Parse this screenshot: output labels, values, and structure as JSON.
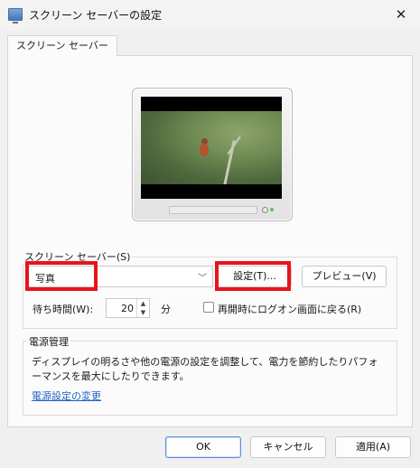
{
  "window": {
    "title": "スクリーン セーバーの設定",
    "close_glyph": "✕",
    "icon": "monitor-icon"
  },
  "tab": {
    "label": "スクリーン セーバー"
  },
  "screensaver": {
    "group_label": "スクリーン セーバー(S)",
    "selected": "写真",
    "settings_button": "設定(T)...",
    "preview_button": "プレビュー(V)",
    "wait_label": "待ち時間(W):",
    "wait_value": "20",
    "wait_unit": "分",
    "resume_logon_label": "再開時にログオン画面に戻る(R)",
    "resume_logon_checked": false
  },
  "power": {
    "group_label": "電源管理",
    "description_line1": "ディスプレイの明るさや他の電源の設定を調整して、電力を節約したりパフォ",
    "description_line2": "ーマンスを最大にしたりできます。",
    "link": "電源設定の変更"
  },
  "footer": {
    "ok": "OK",
    "cancel": "キャンセル",
    "apply": "適用(A)"
  },
  "colors": {
    "highlight": "#e8141c",
    "link": "#1f63c4"
  }
}
